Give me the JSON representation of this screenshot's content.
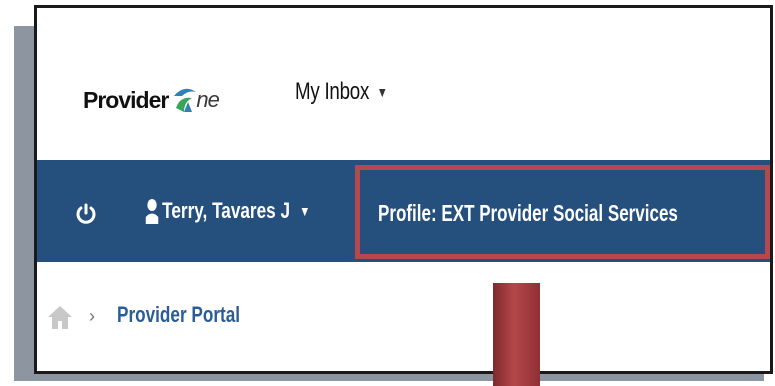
{
  "header": {
    "logo_text": "Provider",
    "logo_suffix": "ne",
    "inbox_label": "My Inbox"
  },
  "navbar": {
    "user_name": "Terry, Tavares J",
    "profile_label": "Profile: EXT Provider Social Services"
  },
  "breadcrumb": {
    "separator": "›",
    "current": "Provider Portal"
  },
  "colors": {
    "nav_bg": "#254f7d",
    "highlight": "#b5484b",
    "link": "#2a5d98"
  }
}
